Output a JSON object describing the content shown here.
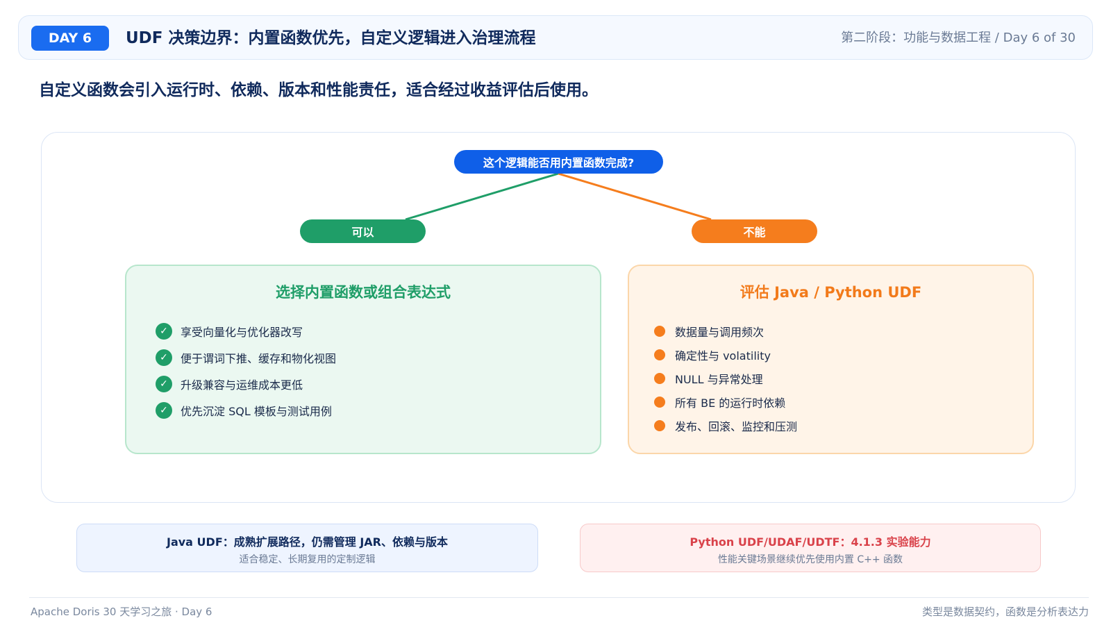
{
  "header": {
    "day_badge": "DAY 6",
    "title": "UDF 决策边界：内置函数优先，自定义逻辑进入治理流程",
    "stage": "第二阶段：功能与数据工程 / Day 6 of 30"
  },
  "subtitle": "自定义函数会引入运行时、依赖、版本和性能责任，适合经过收益评估后使用。",
  "diagram": {
    "question": "这个逻辑能否用内置函数完成?",
    "yes_label": "可以",
    "no_label": "不能",
    "yes_color": "#1f9e68",
    "no_color": "#f57d1d",
    "question_color": "#0f5fe8",
    "yes_card": {
      "title": "选择内置函数或组合表达式",
      "icon": "check-icon",
      "items": [
        "享受向量化与优化器改写",
        "便于谓词下推、缓存和物化视图",
        "升级兼容与运维成本更低",
        "优先沉淀 SQL 模板与测试用例"
      ]
    },
    "no_card": {
      "title": "评估 Java / Python UDF",
      "icon": "bullet-dot-icon",
      "items": [
        "数据量与调用频次",
        "确定性与 volatility",
        "NULL 与异常处理",
        "所有 BE 的运行时依赖",
        "发布、回滚、监控和压测"
      ]
    }
  },
  "notes": {
    "java": {
      "title": "Java UDF：成熟扩展路径，仍需管理 JAR、依赖与版本",
      "subtitle": "适合稳定、长期复用的定制逻辑"
    },
    "python": {
      "title": "Python UDF/UDAF/UDTF：4.1.3 实验能力",
      "subtitle": "性能关键场景继续优先使用内置 C++ 函数"
    }
  },
  "footer": {
    "left": "Apache Doris 30 天学习之旅 · Day 6",
    "right": "类型是数据契约，函数是分析表达力"
  }
}
